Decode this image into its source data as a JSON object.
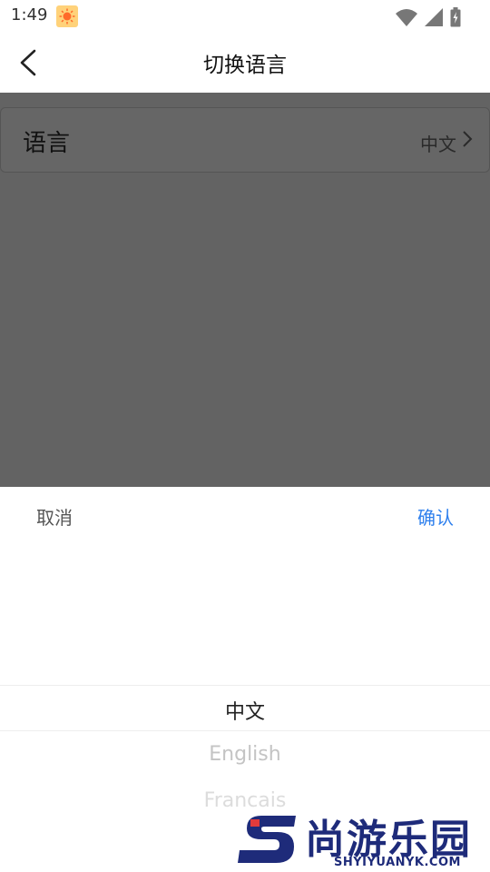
{
  "status_bar": {
    "time": "1:49"
  },
  "header": {
    "title": "切换语言"
  },
  "setting": {
    "label": "语言",
    "value": "中文"
  },
  "picker": {
    "cancel_label": "取消",
    "confirm_label": "确认",
    "options": [
      "中文",
      "English",
      "Francais"
    ],
    "selected_index": 0
  },
  "watermark": {
    "brand": "尚游乐园",
    "domain": "SHYIYUANYK.COM"
  },
  "colors": {
    "accent": "#2f80ed",
    "overlay": "#636363",
    "brand": "#1e2b7a"
  }
}
